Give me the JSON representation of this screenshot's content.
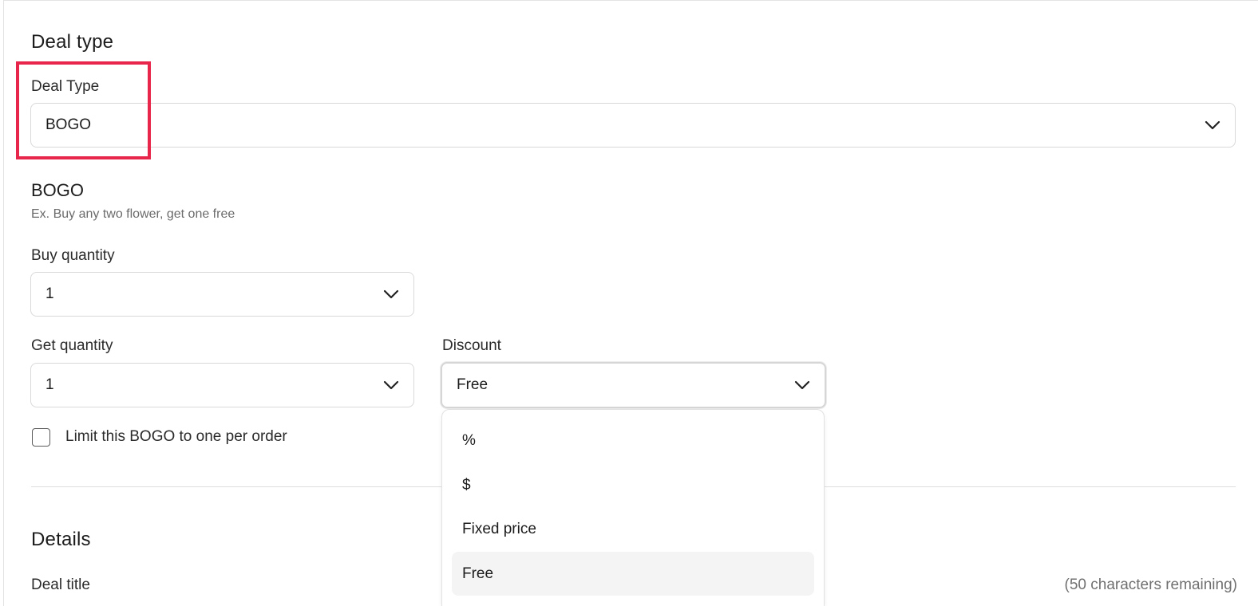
{
  "deal_type_section": {
    "heading": "Deal type",
    "deal_type_label": "Deal Type",
    "deal_type_value": "BOGO"
  },
  "bogo": {
    "title": "BOGO",
    "example": "Ex. Buy any two flower, get one free",
    "buy_quantity_label": "Buy quantity",
    "buy_quantity_value": "1",
    "get_quantity_label": "Get quantity",
    "get_quantity_value": "1",
    "discount_label": "Discount",
    "discount_value": "Free",
    "limit_checkbox_label": "Limit this BOGO to one per order",
    "limit_checked": false
  },
  "discount_menu": {
    "options": [
      "%",
      "$",
      "Fixed price",
      "Free"
    ],
    "selected": "Free"
  },
  "details_section": {
    "heading": "Details",
    "deal_title_label": "Deal title",
    "chars_remaining": "(50 characters remaining)"
  },
  "colors": {
    "highlight": "#e8254b",
    "selected_option_bg": "#f4f4f4"
  }
}
